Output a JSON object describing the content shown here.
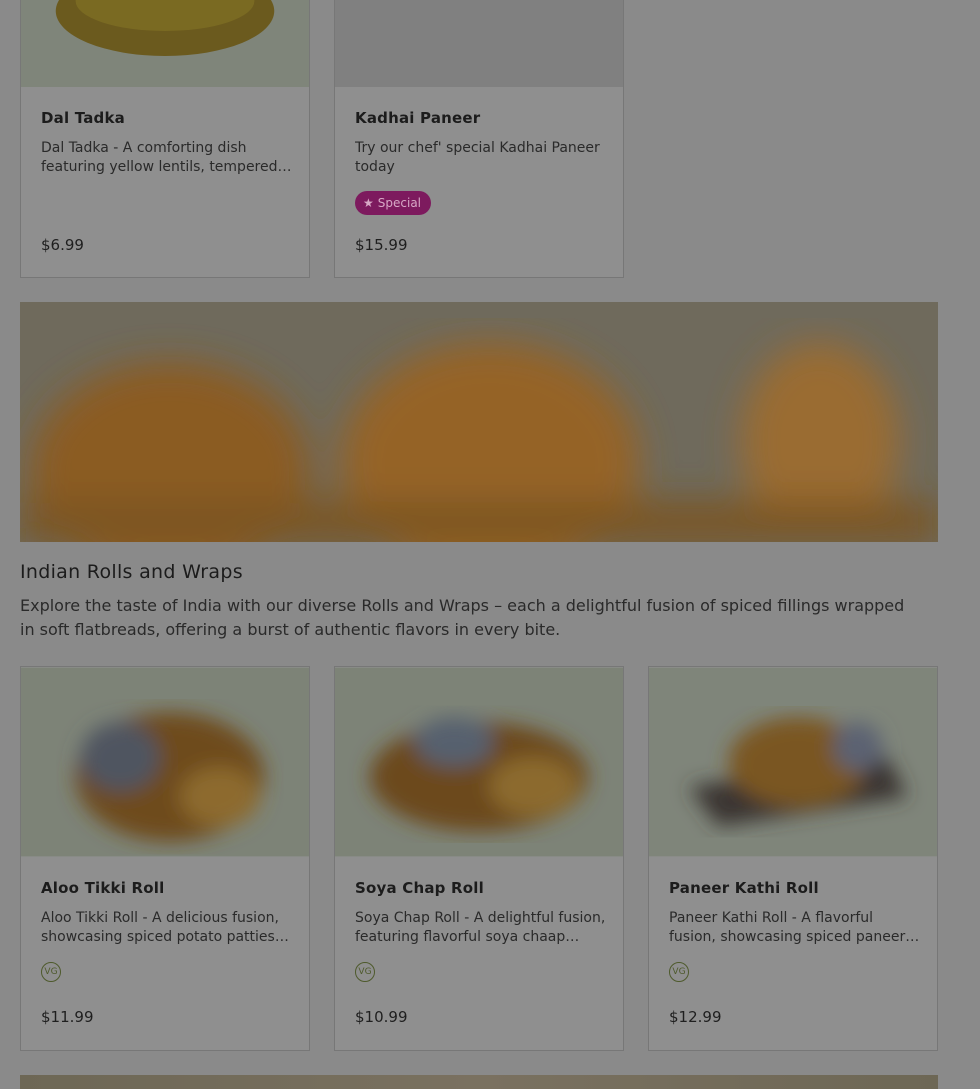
{
  "top_items": [
    {
      "name": "Dal Tadka",
      "description": "Dal Tadka - A comforting dish featuring yellow lentils, tempered with aromatic spices.",
      "price": "$6.99"
    },
    {
      "name": "Kadhai Paneer",
      "description": "Try our chef' special Kadhai Paneer today",
      "price": "$15.99",
      "badge": "Special"
    }
  ],
  "section": {
    "title": "Indian Rolls and Wraps",
    "description": "Explore the taste of India with our diverse Rolls and Wraps – each a delightful fusion of spiced fillings wrapped in soft flatbreads, offering a burst of authentic flavors in every bite."
  },
  "rolls": [
    {
      "name": "Aloo Tikki Roll",
      "description": "Aloo Tikki Roll - A delicious fusion, showcasing spiced potato patties wrapped in flatbread.",
      "tag": "VG",
      "price": "$11.99"
    },
    {
      "name": "Soya Chap Roll",
      "description": "Soya Chap Roll - A delightful fusion, featuring flavorful soya chaap wrapped in flatbread.",
      "tag": "VG",
      "price": "$10.99"
    },
    {
      "name": "Paneer Kathi Roll",
      "description": "Paneer Kathi Roll - A flavorful fusion, showcasing spiced paneer wrapped in flatbread.",
      "tag": "VG",
      "price": "$12.99"
    }
  ],
  "colors": {
    "overlay": "#8a8a8a",
    "badge": "#7d1a5e"
  },
  "icons": {
    "badge": "star-icon"
  }
}
